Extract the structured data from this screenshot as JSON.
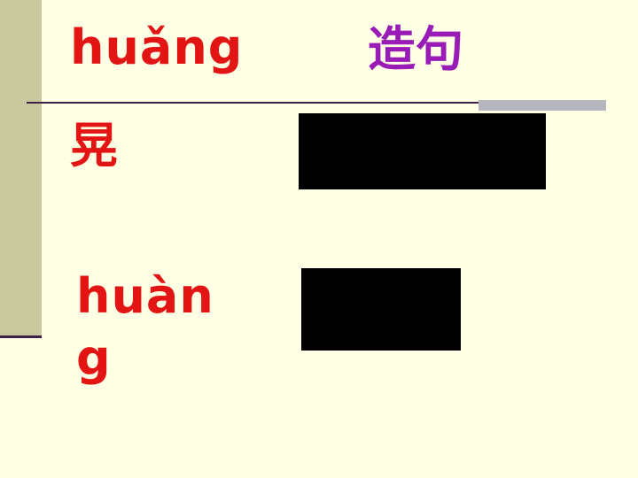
{
  "slide": {
    "header_pinyin": "huǎng",
    "header_task": "造句",
    "character": "晃",
    "alt_pinyin_line1": "huàn",
    "alt_pinyin_line2": "g"
  },
  "colors": {
    "background": "#FFFFE5",
    "left_bar": "#C9C79E",
    "accent_line": "#3F1F46",
    "highlight_gray": "#B6B6C0",
    "red_text": "#E31414",
    "purple_text": "#9A1CB6",
    "redaction": "#000000"
  }
}
